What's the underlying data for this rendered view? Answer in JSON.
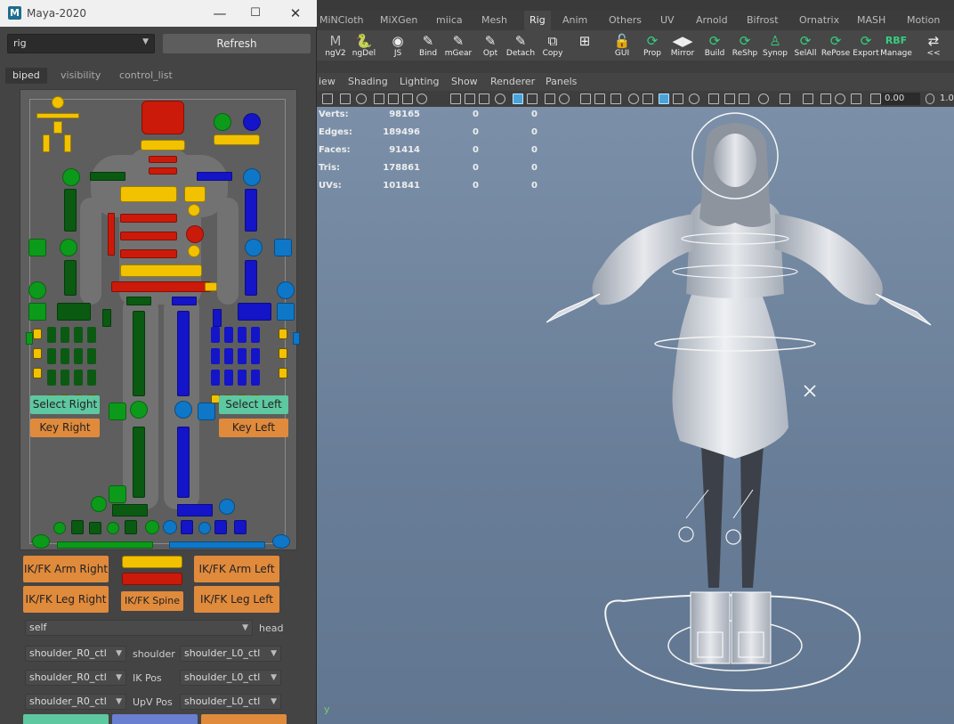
{
  "picker": {
    "window_title": "Maya-2020",
    "minimize": "—",
    "maximize": "☐",
    "close": "✕",
    "namespace": "rig",
    "refresh_label": "Refresh",
    "tabs": [
      "biped",
      "visibility",
      "control_list"
    ],
    "select_right": "Select Right",
    "key_right": "Key Right",
    "select_left": "Select Left",
    "key_left": "Key Left",
    "ikfk_arm_right": "IK/FK Arm Right",
    "ikfk_arm_left": "IK/FK Arm Left",
    "ikfk_leg_right": "IK/FK Leg Right",
    "ikfk_leg_left": "IK/FK Leg Left",
    "ikfk_spine": "IK/FK Spine",
    "space_combo": "self",
    "space_label": "head",
    "rows": [
      {
        "left": "shoulder_R0_ctl",
        "label": "shoulder",
        "right": "shoulder_L0_ctl"
      },
      {
        "left": "shoulder_R0_ctl",
        "label": "IK Pos",
        "right": "shoulder_L0_ctl"
      },
      {
        "left": "shoulder_R0_ctl",
        "label": "UpV Pos",
        "right": "shoulder_L0_ctl"
      }
    ]
  },
  "maya": {
    "shelf_tabs": [
      "MiNCloth",
      "MiXGen",
      "miica",
      "Mesh",
      "Rig",
      "Anim",
      "Others",
      "UV",
      "Arnold",
      "Bifrost",
      "Ornatrix",
      "MASH",
      "Motion Gra"
    ],
    "active_tab": "Rig",
    "shelf_icons": [
      {
        "label": "ngV2",
        "icon": "maya-icon"
      },
      {
        "label": "ngDel",
        "icon": "python-icon"
      },
      {
        "label": "JS",
        "icon": "eye-icon"
      },
      {
        "label": "Bind",
        "icon": "brush-icon"
      },
      {
        "label": "mGear",
        "icon": "brush-icon"
      },
      {
        "label": "Opt",
        "icon": "brush-icon"
      },
      {
        "label": "Detach",
        "icon": "brush-icon"
      },
      {
        "label": "Copy",
        "icon": "copy-icon"
      },
      {
        "label": "",
        "icon": "grid-icon"
      },
      {
        "label": "GUI",
        "icon": "lock-icon"
      },
      {
        "label": "Prop",
        "icon": "refresh-icon"
      },
      {
        "label": "Mirror",
        "icon": "mirror-icon"
      },
      {
        "label": "Build",
        "icon": "refresh-icon"
      },
      {
        "label": "ReShp",
        "icon": "refresh-icon"
      },
      {
        "label": "Synop",
        "icon": "person-icon"
      },
      {
        "label": "SelAll",
        "icon": "refresh-icon"
      },
      {
        "label": "RePose",
        "icon": "refresh-icon"
      },
      {
        "label": "Export",
        "icon": "refresh-icon"
      },
      {
        "label": "Manage",
        "icon": "rbf-icon"
      },
      {
        "label": "<<",
        "icon": "arrows-icon"
      }
    ],
    "panel_menus": [
      "iew",
      "Shading",
      "Lighting",
      "Show",
      "Renderer",
      "Panels"
    ],
    "exposure": "0.00",
    "gamma": "1.0",
    "hud": [
      {
        "label": "Verts:",
        "v1": "98165",
        "v2": "0",
        "v3": "0"
      },
      {
        "label": "Edges:",
        "v1": "189496",
        "v2": "0",
        "v3": "0"
      },
      {
        "label": "Faces:",
        "v1": "91414",
        "v2": "0",
        "v3": "0"
      },
      {
        "label": "Tris:",
        "v1": "178861",
        "v2": "0",
        "v3": "0"
      },
      {
        "label": "UVs:",
        "v1": "101841",
        "v2": "0",
        "v3": "0"
      }
    ],
    "axis_label": "y"
  },
  "colors": {
    "ctl_yellow": "#f2c200",
    "ctl_red": "#cc1a0a",
    "ctl_green": "#0c9a1a",
    "ctl_darkgreen": "#0a5a12",
    "ctl_blue": "#1414c8",
    "ctl_lightblue": "#0f77c8",
    "btn_select": "#5ec8a0",
    "btn_key": "#e08a3c"
  }
}
